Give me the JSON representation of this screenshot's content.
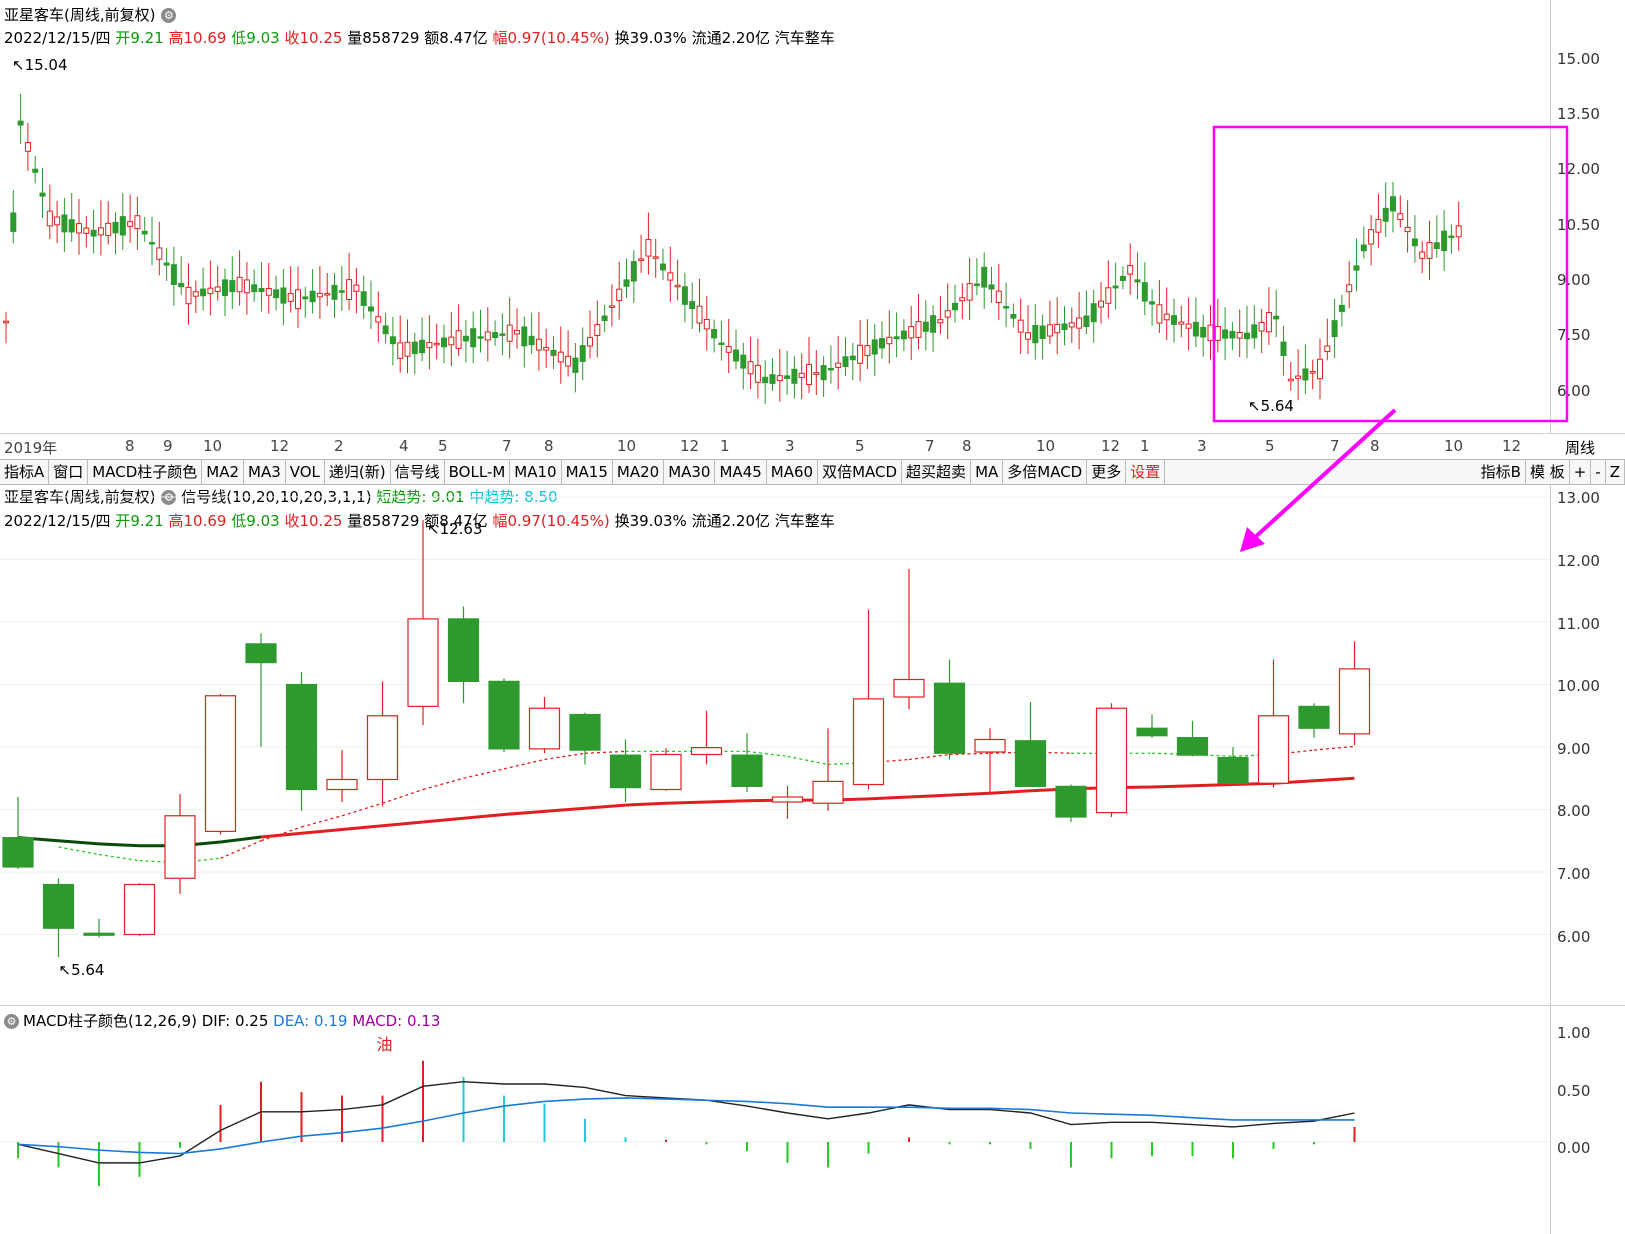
{
  "top": {
    "title": "亚星客车(周线,前复权)",
    "info": {
      "date": "2022/12/15/四",
      "open_label": "开",
      "open": "9.21",
      "high_label": "高",
      "high": "10.69",
      "low_label": "低",
      "low": "9.03",
      "close_label": "收",
      "close": "10.25",
      "vol_label": "量",
      "vol": "858729",
      "amount_label": "额",
      "amount": "8.47亿",
      "change_label": "幅",
      "change": "0.97(10.45%)",
      "turnover_label": "换",
      "turnover": "39.03%",
      "float_label": "流通",
      "float": "2.20亿",
      "industry": "汽车整车"
    },
    "axis_ticks": [
      "15.00",
      "13.50",
      "12.00",
      "10.50",
      "9.00",
      "7.50",
      "6.00"
    ],
    "max_label": "15.04",
    "min_label": "5.64",
    "date_labels": [
      "2019年",
      "8",
      "9",
      "10",
      "12",
      "2",
      "4",
      "5",
      "7",
      "8",
      "10",
      "12",
      "1",
      "3",
      "5",
      "7",
      "8",
      "10",
      "12",
      "1",
      "3",
      "5",
      "7",
      "8",
      "10",
      "12"
    ],
    "period_label": "周线"
  },
  "tabs": [
    "指标A",
    "窗口",
    "MACD柱子颜色",
    "MA2",
    "MA3",
    "VOL",
    "递归(新)",
    "信号线",
    "BOLL-M",
    "MA10",
    "MA15",
    "MA20",
    "MA30",
    "MA45",
    "MA60",
    "双倍MACD",
    "超买超卖",
    "MA",
    "多倍MACD",
    "更多",
    "设置"
  ],
  "tabs_right": [
    "指标B",
    "模 板",
    "+",
    "-",
    "Z"
  ],
  "middle": {
    "title": "亚星客车(周线,前复权)",
    "indicator": "信号线(10,20,10,20,3,1,1)",
    "short_label": "短趋势: 9.01",
    "mid_label": "中趋势: 8.50",
    "axis_ticks": [
      "13.00",
      "12.00",
      "11.00",
      "10.00",
      "9.00",
      "8.00",
      "7.00",
      "6.00"
    ],
    "max_label": "12.63",
    "min_label": "5.64"
  },
  "macd": {
    "title": "MACD柱子颜色(12,26,9)",
    "dif": "DIF: 0.25",
    "dea": "DEA: 0.19",
    "macd": "MACD: 0.13",
    "axis_ticks": [
      "1.00",
      "0.50",
      "0.00"
    ],
    "annotation": "油"
  },
  "chart_data": {
    "type": "candlestick",
    "title": "亚星客车(周线,前复权)",
    "period": "weekly",
    "ylim": [
      5.5,
      13.0
    ],
    "candles": [
      {
        "o": 7.55,
        "h": 8.2,
        "l": 7.05,
        "c": 7.08
      },
      {
        "o": 6.8,
        "h": 6.9,
        "l": 5.64,
        "c": 6.1
      },
      {
        "o": 6.02,
        "h": 6.25,
        "l": 5.95,
        "c": 6.0
      },
      {
        "o": 6.0,
        "h": 6.82,
        "l": 5.98,
        "c": 6.8
      },
      {
        "o": 6.9,
        "h": 8.25,
        "l": 6.65,
        "c": 7.9
      },
      {
        "o": 7.65,
        "h": 9.85,
        "l": 7.6,
        "c": 9.82
      },
      {
        "o": 10.65,
        "h": 10.82,
        "l": 9.0,
        "c": 10.35
      },
      {
        "o": 10.0,
        "h": 10.2,
        "l": 7.98,
        "c": 8.32
      },
      {
        "o": 8.32,
        "h": 8.95,
        "l": 8.12,
        "c": 8.48
      },
      {
        "o": 8.48,
        "h": 10.05,
        "l": 8.05,
        "c": 9.5
      },
      {
        "o": 9.65,
        "h": 12.63,
        "l": 9.35,
        "c": 11.05
      },
      {
        "o": 11.05,
        "h": 11.25,
        "l": 9.7,
        "c": 10.05
      },
      {
        "o": 10.05,
        "h": 10.1,
        "l": 8.92,
        "c": 8.97
      },
      {
        "o": 8.97,
        "h": 9.8,
        "l": 8.9,
        "c": 9.62
      },
      {
        "o": 9.52,
        "h": 9.55,
        "l": 8.72,
        "c": 8.95
      },
      {
        "o": 8.87,
        "h": 9.12,
        "l": 8.12,
        "c": 8.35
      },
      {
        "o": 8.32,
        "h": 8.98,
        "l": 8.3,
        "c": 8.88
      },
      {
        "o": 8.88,
        "h": 9.58,
        "l": 8.72,
        "c": 8.99
      },
      {
        "o": 8.87,
        "h": 9.22,
        "l": 8.28,
        "c": 8.37
      },
      {
        "o": 8.12,
        "h": 8.38,
        "l": 7.85,
        "c": 8.2
      },
      {
        "o": 8.1,
        "h": 9.3,
        "l": 7.98,
        "c": 8.45
      },
      {
        "o": 8.4,
        "h": 11.2,
        "l": 8.32,
        "c": 9.77
      },
      {
        "o": 9.8,
        "h": 11.85,
        "l": 9.6,
        "c": 10.08
      },
      {
        "o": 10.02,
        "h": 10.4,
        "l": 8.8,
        "c": 8.9
      },
      {
        "o": 8.92,
        "h": 9.3,
        "l": 8.25,
        "c": 9.12
      },
      {
        "o": 9.1,
        "h": 9.72,
        "l": 8.38,
        "c": 8.37
      },
      {
        "o": 8.37,
        "h": 8.4,
        "l": 7.8,
        "c": 7.88
      },
      {
        "o": 7.95,
        "h": 9.7,
        "l": 7.88,
        "c": 9.62
      },
      {
        "o": 9.3,
        "h": 9.52,
        "l": 9.15,
        "c": 9.18
      },
      {
        "o": 9.15,
        "h": 9.42,
        "l": 8.85,
        "c": 8.87
      },
      {
        "o": 8.83,
        "h": 9.0,
        "l": 8.42,
        "c": 8.42
      },
      {
        "o": 8.42,
        "h": 10.4,
        "l": 8.35,
        "c": 9.5
      },
      {
        "o": 9.65,
        "h": 9.7,
        "l": 9.15,
        "c": 9.3
      },
      {
        "o": 9.21,
        "h": 10.69,
        "l": 9.03,
        "c": 10.25
      }
    ],
    "ma_long": [
      7.55,
      7.5,
      7.45,
      7.42,
      7.42,
      7.48,
      7.56,
      7.62,
      7.68,
      7.74,
      7.8,
      7.86,
      7.92,
      7.97,
      8.02,
      8.07,
      8.1,
      8.12,
      8.14,
      8.15,
      8.15,
      8.17,
      8.2,
      8.23,
      8.26,
      8.3,
      8.33,
      8.35,
      8.36,
      8.38,
      8.4,
      8.42,
      8.46,
      8.5
    ],
    "ma_short": [
      null,
      7.4,
      7.28,
      7.18,
      7.15,
      7.22,
      7.5,
      7.72,
      7.9,
      8.1,
      8.32,
      8.5,
      8.65,
      8.8,
      8.9,
      8.93,
      8.93,
      8.93,
      8.93,
      8.85,
      8.72,
      8.75,
      8.8,
      8.88,
      8.9,
      8.92,
      8.9,
      8.9,
      8.9,
      8.88,
      8.85,
      8.88,
      8.95,
      9.01
    ],
    "macd_dif": [
      -0.02,
      -0.1,
      -0.18,
      -0.18,
      -0.12,
      0.1,
      0.26,
      0.26,
      0.28,
      0.32,
      0.48,
      0.52,
      0.5,
      0.5,
      0.47,
      0.4,
      0.38,
      0.36,
      0.31,
      0.25,
      0.2,
      0.25,
      0.32,
      0.28,
      0.28,
      0.25,
      0.15,
      0.17,
      0.17,
      0.15,
      0.13,
      0.16,
      0.18,
      0.25
    ],
    "macd_dea": [
      -0.02,
      -0.04,
      -0.07,
      -0.09,
      -0.1,
      -0.06,
      0.0,
      0.05,
      0.08,
      0.12,
      0.18,
      0.25,
      0.31,
      0.35,
      0.37,
      0.38,
      0.37,
      0.36,
      0.35,
      0.33,
      0.3,
      0.3,
      0.3,
      0.29,
      0.29,
      0.28,
      0.25,
      0.24,
      0.23,
      0.21,
      0.19,
      0.19,
      0.19,
      0.19
    ],
    "macd_hist": [
      -0.14,
      -0.22,
      -0.38,
      -0.3,
      -0.05,
      0.32,
      0.52,
      0.43,
      0.4,
      0.4,
      0.7,
      0.56,
      0.4,
      0.33,
      0.2,
      0.04,
      0.02,
      -0.02,
      -0.08,
      -0.18,
      -0.22,
      -0.1,
      0.04,
      -0.02,
      -0.02,
      -0.06,
      -0.22,
      -0.14,
      -0.12,
      -0.12,
      -0.14,
      -0.06,
      -0.02,
      0.13
    ]
  }
}
